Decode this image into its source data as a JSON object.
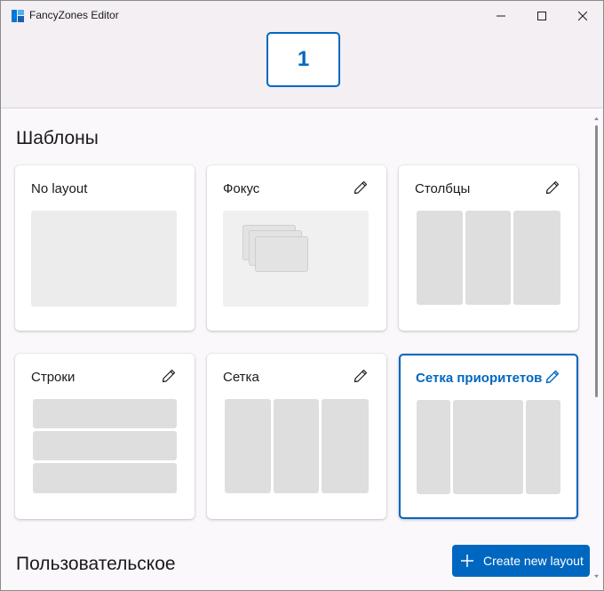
{
  "window": {
    "title": "FancyZones Editor",
    "accent": "#0067c0"
  },
  "controls": {
    "minimize": "minimize-icon",
    "maximize": "maximize-icon",
    "close": "close-icon"
  },
  "monitors": [
    {
      "label": "1",
      "selected": true
    }
  ],
  "templates": {
    "heading": "Шаблоны",
    "cards": [
      {
        "name": "No layout",
        "editable": false,
        "selected": false
      },
      {
        "name": "Фокус",
        "editable": true,
        "selected": false
      },
      {
        "name": "Столбцы",
        "editable": true,
        "selected": false
      },
      {
        "name": "Строки",
        "editable": true,
        "selected": false
      },
      {
        "name": "Сетка",
        "editable": true,
        "selected": false
      },
      {
        "name": "Сетка приоритетов",
        "editable": true,
        "selected": true
      }
    ]
  },
  "custom": {
    "heading": "Пользовательское",
    "create_label": "Create new layout",
    "create_icon": "plus-icon"
  }
}
